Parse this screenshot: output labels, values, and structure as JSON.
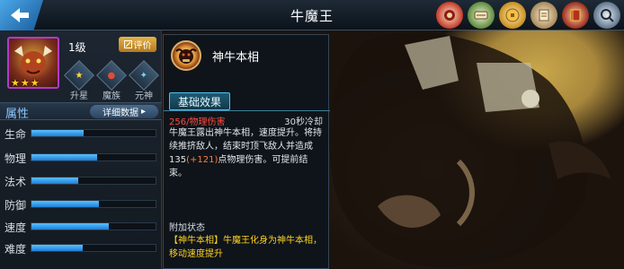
{
  "header": {
    "title": "牛魔王",
    "icons": [
      "back-arrow-icon",
      "seal-medal-icon",
      "scroll-icon",
      "coin-icon",
      "parchment-icon",
      "book-icon",
      "magnifier-icon"
    ]
  },
  "hero": {
    "level": "1级",
    "stars": 3,
    "rate_label": "评价",
    "skill_buttons": [
      {
        "label": "升星",
        "icon": "star-up-icon"
      },
      {
        "label": "魔族",
        "icon": "demon-clan-icon"
      },
      {
        "label": "元神",
        "icon": "spirit-icon"
      }
    ]
  },
  "attributes": {
    "title": "属性",
    "detail_label": "详细数据",
    "stats": [
      {
        "label": "生命",
        "value": 0.42
      },
      {
        "label": "物理",
        "value": 0.53
      },
      {
        "label": "法术",
        "value": 0.38
      },
      {
        "label": "防御",
        "value": 0.54
      },
      {
        "label": "速度",
        "value": 0.62
      },
      {
        "label": "难度",
        "value": 0.41
      }
    ]
  },
  "skill": {
    "name": "神牛本相",
    "tab_label": "基础效果",
    "damage_type": "256/物理伤害",
    "cooldown": "30秒冷却",
    "desc_main": "牛魔王露出神牛本相，速度提升。将持续推挤敌人，结束时顶飞敌人并造成135",
    "desc_bonus": "(+121)",
    "desc_tail": "点物理伤害。可提前结束。",
    "extra_title": "附加状态",
    "extra_desc": "【神牛本相】牛魔王化身为神牛本相，移动速度提升"
  },
  "colors": {
    "accent_blue": "#46c7f0",
    "damage_red": "#ff4a3c",
    "bonus_orange": "#ff7e3a",
    "status_yellow": "#ffd21f",
    "rarity_purple": "#b23ac7"
  }
}
